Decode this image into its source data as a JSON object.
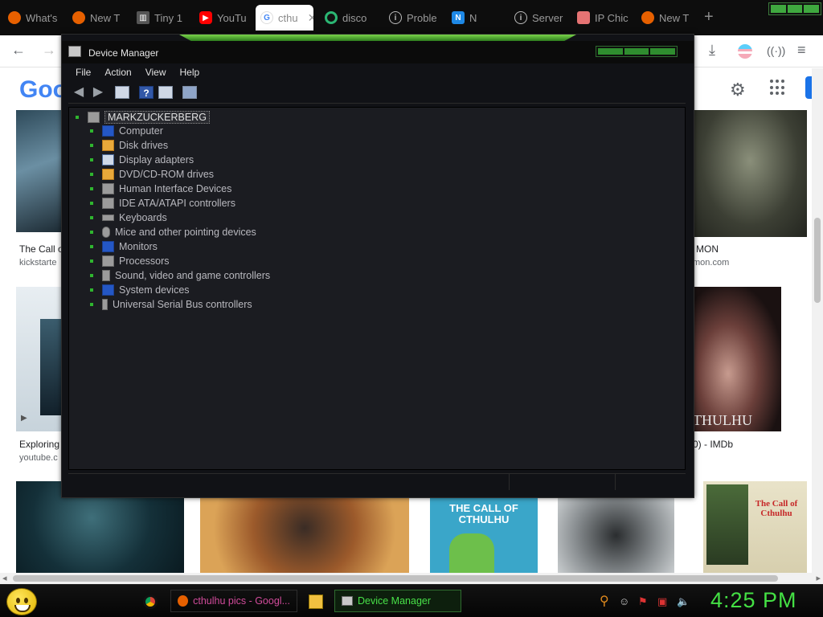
{
  "browser": {
    "tabs": [
      {
        "label": "What's",
        "icon": "firefox-icon",
        "color": "#e66000"
      },
      {
        "label": "New T",
        "icon": "firefox-icon",
        "color": "#e66000"
      },
      {
        "label": "Tiny 1",
        "icon": "bank-icon",
        "color": "#bbbbbb"
      },
      {
        "label": "YouTu",
        "icon": "youtube-icon",
        "color": "#ff0000"
      },
      {
        "label": "cthu",
        "icon": "google-icon",
        "color": "#4285f4",
        "active": true
      },
      {
        "label": "disco",
        "icon": "ring-icon",
        "color": "#2bb673"
      },
      {
        "label": "Proble",
        "icon": "info-icon",
        "color": "#bbbbbb"
      },
      {
        "label": "N",
        "icon": "n-app-icon",
        "color": "#1e88e5"
      },
      {
        "label": "Server",
        "icon": "info-icon",
        "color": "#bbbbbb"
      },
      {
        "label": "IP Chic",
        "icon": "chick-icon",
        "color": "#e57373"
      },
      {
        "label": "New T",
        "icon": "firefox-icon",
        "color": "#e66000"
      }
    ],
    "new_tab_glyph": "+"
  },
  "google": {
    "logo_text": "Goog",
    "results": [
      {
        "caption": "The Call o",
        "source": "kickstarte"
      },
      {
        "caption": "MON",
        "source": "mon.com"
      },
      {
        "caption": "Exploring",
        "source": "youtube.c"
      },
      {
        "caption": "0) - IMDb",
        "source": ""
      }
    ],
    "poster_text": "THULHU",
    "book1_title": "THE CALL OF CTHULHU",
    "book2_title": "The Call of Cthulhu"
  },
  "device_manager": {
    "title": "Device Manager",
    "menu": [
      "File",
      "Action",
      "View",
      "Help"
    ],
    "root": "MARKZUCKERBERG",
    "categories": [
      {
        "label": "Computer",
        "icon": "computer-icon"
      },
      {
        "label": "Disk drives",
        "icon": "disk-drive-icon"
      },
      {
        "label": "Display adapters",
        "icon": "display-adapter-icon"
      },
      {
        "label": "DVD/CD-ROM drives",
        "icon": "dvd-drive-icon"
      },
      {
        "label": "Human Interface Devices",
        "icon": "hid-icon"
      },
      {
        "label": "IDE ATA/ATAPI controllers",
        "icon": "ide-controller-icon"
      },
      {
        "label": "Keyboards",
        "icon": "keyboard-icon"
      },
      {
        "label": "Mice and other pointing devices",
        "icon": "mouse-icon"
      },
      {
        "label": "Monitors",
        "icon": "monitor-icon"
      },
      {
        "label": "Processors",
        "icon": "processor-icon"
      },
      {
        "label": "Sound, video and game controllers",
        "icon": "speaker-icon"
      },
      {
        "label": "System devices",
        "icon": "system-devices-icon"
      },
      {
        "label": "Universal Serial Bus controllers",
        "icon": "usb-icon"
      }
    ]
  },
  "taskbar": {
    "tasks": [
      "cthulhu pics - Googl...",
      "Device Manager"
    ],
    "clock": "4:25 PM",
    "accent": "#44e044"
  }
}
